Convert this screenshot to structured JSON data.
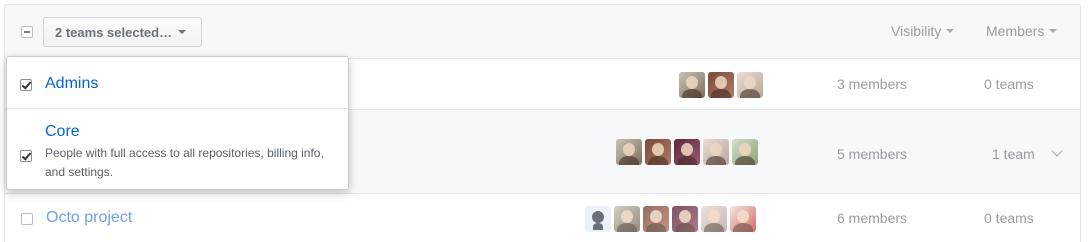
{
  "header": {
    "bulk_button_label": "2 teams selected…",
    "filters": [
      "Visibility",
      "Members"
    ]
  },
  "teams": [
    {
      "name": "Admins",
      "description": "",
      "checked": true,
      "member_avatars": [
        "avatar-a",
        "avatar-b",
        "avatar-c"
      ],
      "members": "3 members",
      "teams": "0 teams"
    },
    {
      "name": "Core",
      "description": "People with full access to all repositories, billing info, and settings.",
      "checked": true,
      "member_avatars": [
        "avatar-a",
        "avatar-b",
        "avatar-d",
        "avatar-c",
        "avatar-e"
      ],
      "members": "5 members",
      "teams": "1 team",
      "expand_icon": "chevron-down-icon"
    },
    {
      "name": "Octo project",
      "description": "",
      "checked": false,
      "member_avatars": [
        "octocat-avatar",
        "avatar-a",
        "avatar-b",
        "avatar-d",
        "avatar-c",
        "avatar-f"
      ],
      "members": "6 members",
      "teams": "0 teams"
    }
  ]
}
